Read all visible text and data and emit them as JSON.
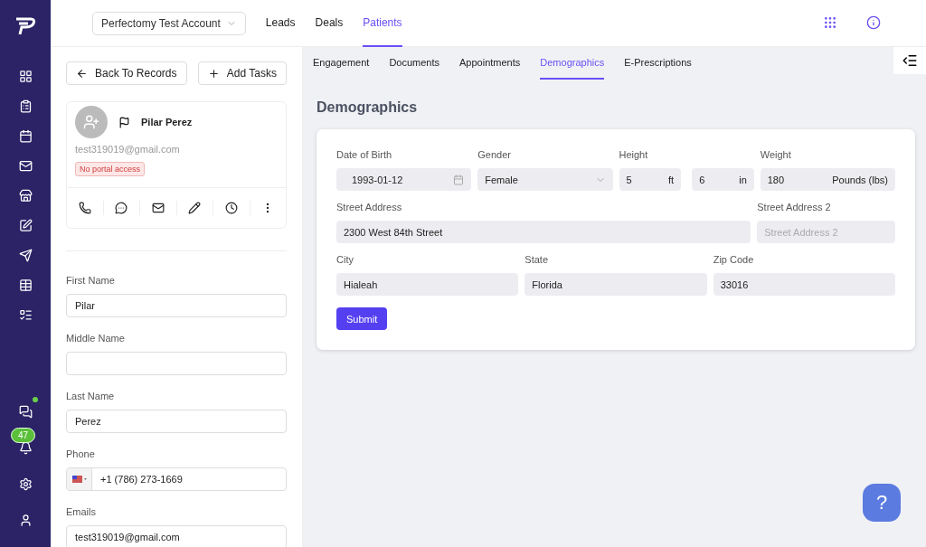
{
  "account_selector": {
    "label": "Perfectomy Test Account"
  },
  "top_nav": [
    {
      "label": "Leads",
      "selected": false
    },
    {
      "label": "Deals",
      "selected": false
    },
    {
      "label": "Patients",
      "selected": true
    }
  ],
  "record_actions": [
    {
      "label": "Back To Records",
      "kind": "back"
    },
    {
      "label": "Add Tasks",
      "kind": "add"
    }
  ],
  "contact": {
    "name": "Pilar Perez",
    "email": "test319019@gmail.com",
    "badge": "No portal access"
  },
  "fields": [
    {
      "label": "First Name",
      "kind": "text",
      "value": "Pilar"
    },
    {
      "label": "Middle Name",
      "kind": "text"
    },
    {
      "label": "Last Name",
      "kind": "text",
      "value": "Perez"
    },
    {
      "label": "Phone",
      "kind": "phone",
      "value": "+1 (786) 273-1669"
    },
    {
      "label": "Emails",
      "kind": "text",
      "value": "test319019@gmail.com"
    }
  ],
  "notification_count": "47",
  "sub_tabs": [
    {
      "label": "Engagement",
      "selected": false
    },
    {
      "label": "Documents",
      "selected": false
    },
    {
      "label": "Appointments",
      "selected": false
    },
    {
      "label": "Demographics",
      "selected": true
    },
    {
      "label": "E-Prescriptions",
      "selected": false
    }
  ],
  "section_title": "Demographics",
  "form": {
    "vitals": [
      {
        "label": "Date of Birth",
        "kind": "date",
        "value": "1993-01-12"
      },
      {
        "label": "Gender",
        "kind": "select",
        "value": "Female"
      },
      {
        "label": "Height",
        "kind": "measure",
        "parts": [
          {
            "value": "5",
            "unit": "ft"
          },
          {
            "value": "6",
            "unit": "in"
          }
        ]
      },
      {
        "label": "Weight",
        "kind": "measure",
        "parts": [
          {
            "value": "180",
            "unit": "Pounds (lbs)"
          }
        ]
      }
    ],
    "street_address": {
      "label": "Street Address",
      "kind": "text",
      "value": "2300 West 84th Street"
    },
    "street_address_2": {
      "label": "Street Address 2",
      "kind": "text",
      "placeholder": "Street Address 2"
    },
    "locality": [
      {
        "label": "City",
        "kind": "text",
        "value": "Hialeah"
      },
      {
        "label": "State",
        "kind": "text",
        "value": "Florida"
      },
      {
        "label": "Zip Code",
        "kind": "text",
        "value": "33016"
      }
    ],
    "submit": "Submit"
  },
  "help_button": "?"
}
